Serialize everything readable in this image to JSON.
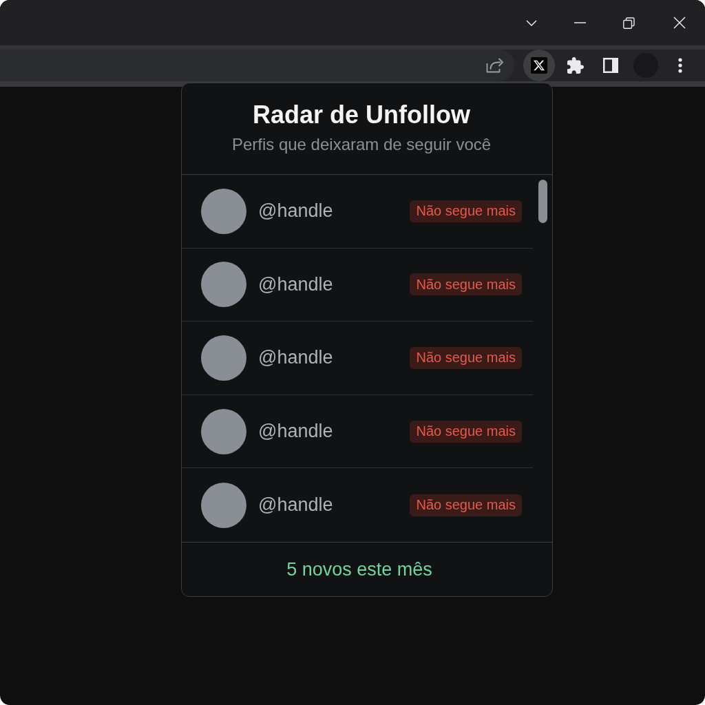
{
  "toolbar": {
    "extension": {
      "active": true
    }
  },
  "popup": {
    "title": "Radar de Unfollow",
    "subtitle": "Perfis que deixaram de seguir você",
    "rows": [
      {
        "handle": "@handle",
        "status": "Não segue mais"
      },
      {
        "handle": "@handle",
        "status": "Não segue mais"
      },
      {
        "handle": "@handle",
        "status": "Não segue mais"
      },
      {
        "handle": "@handle",
        "status": "Não segue mais"
      },
      {
        "handle": "@handle",
        "status": "Não segue mais"
      }
    ],
    "footer": "5 novos este mês"
  }
}
